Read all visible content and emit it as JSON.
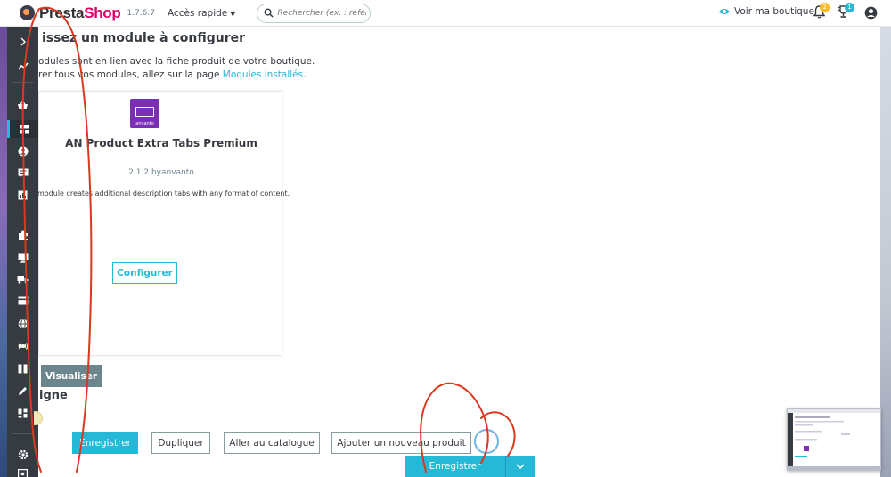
{
  "header": {
    "logo_text_a": "Presta",
    "logo_text_b": "Shop",
    "version": "1.7.6.7",
    "quick_access": "Accès rapide",
    "search_placeholder": "Rechercher (ex. : référe",
    "view_shop": "Voir ma boutique",
    "notifications_badge": "2",
    "orders_badge": "1"
  },
  "colors": {
    "accent": "#25b9d7",
    "sidebar": "#363a41",
    "brand_pink": "#df0067",
    "module_logo": "#7a2fb5",
    "annotation": "#d9391f"
  },
  "page": {
    "title": "issez un module à configurer",
    "desc_line1": "odules sont en lien avec la fiche produit de votre boutique.",
    "desc_line2_text": "rer tous vos modules, allez sur la page ",
    "desc_line2_link": "Modules installés",
    "desc_line2_end": "."
  },
  "module_card": {
    "logo_text": "anvanto",
    "name": "AN Product Extra Tabs Premium",
    "version": "2.1.2 byanvanto",
    "description": "module creates additional description tabs with any format of content.",
    "configure_label": "Configurer"
  },
  "visualize_label": "Visualiser",
  "section_label": "igne",
  "footer_buttons": {
    "save": "Enregistrer",
    "duplicate": "Dupliquer",
    "go_catalog": "Aller au catalogue",
    "add_product": "Ajouter un nouveau produit",
    "save_main": "Enregistrer"
  },
  "sidebar_icons": [
    "expand-icon",
    "dashboard-icon",
    "orders-basket-icon",
    "catalog-icon",
    "customers-icon",
    "customer-service-icon",
    "stats-icon",
    "modules-puzzle-icon",
    "design-monitor-icon",
    "shipping-truck-icon",
    "payment-card-icon",
    "international-globe-icon",
    "shop-parameters-icon",
    "advanced-parameters-icon",
    "pencil-icon",
    "grid-icon",
    "settings-gear-icon",
    "logout-icon"
  ]
}
